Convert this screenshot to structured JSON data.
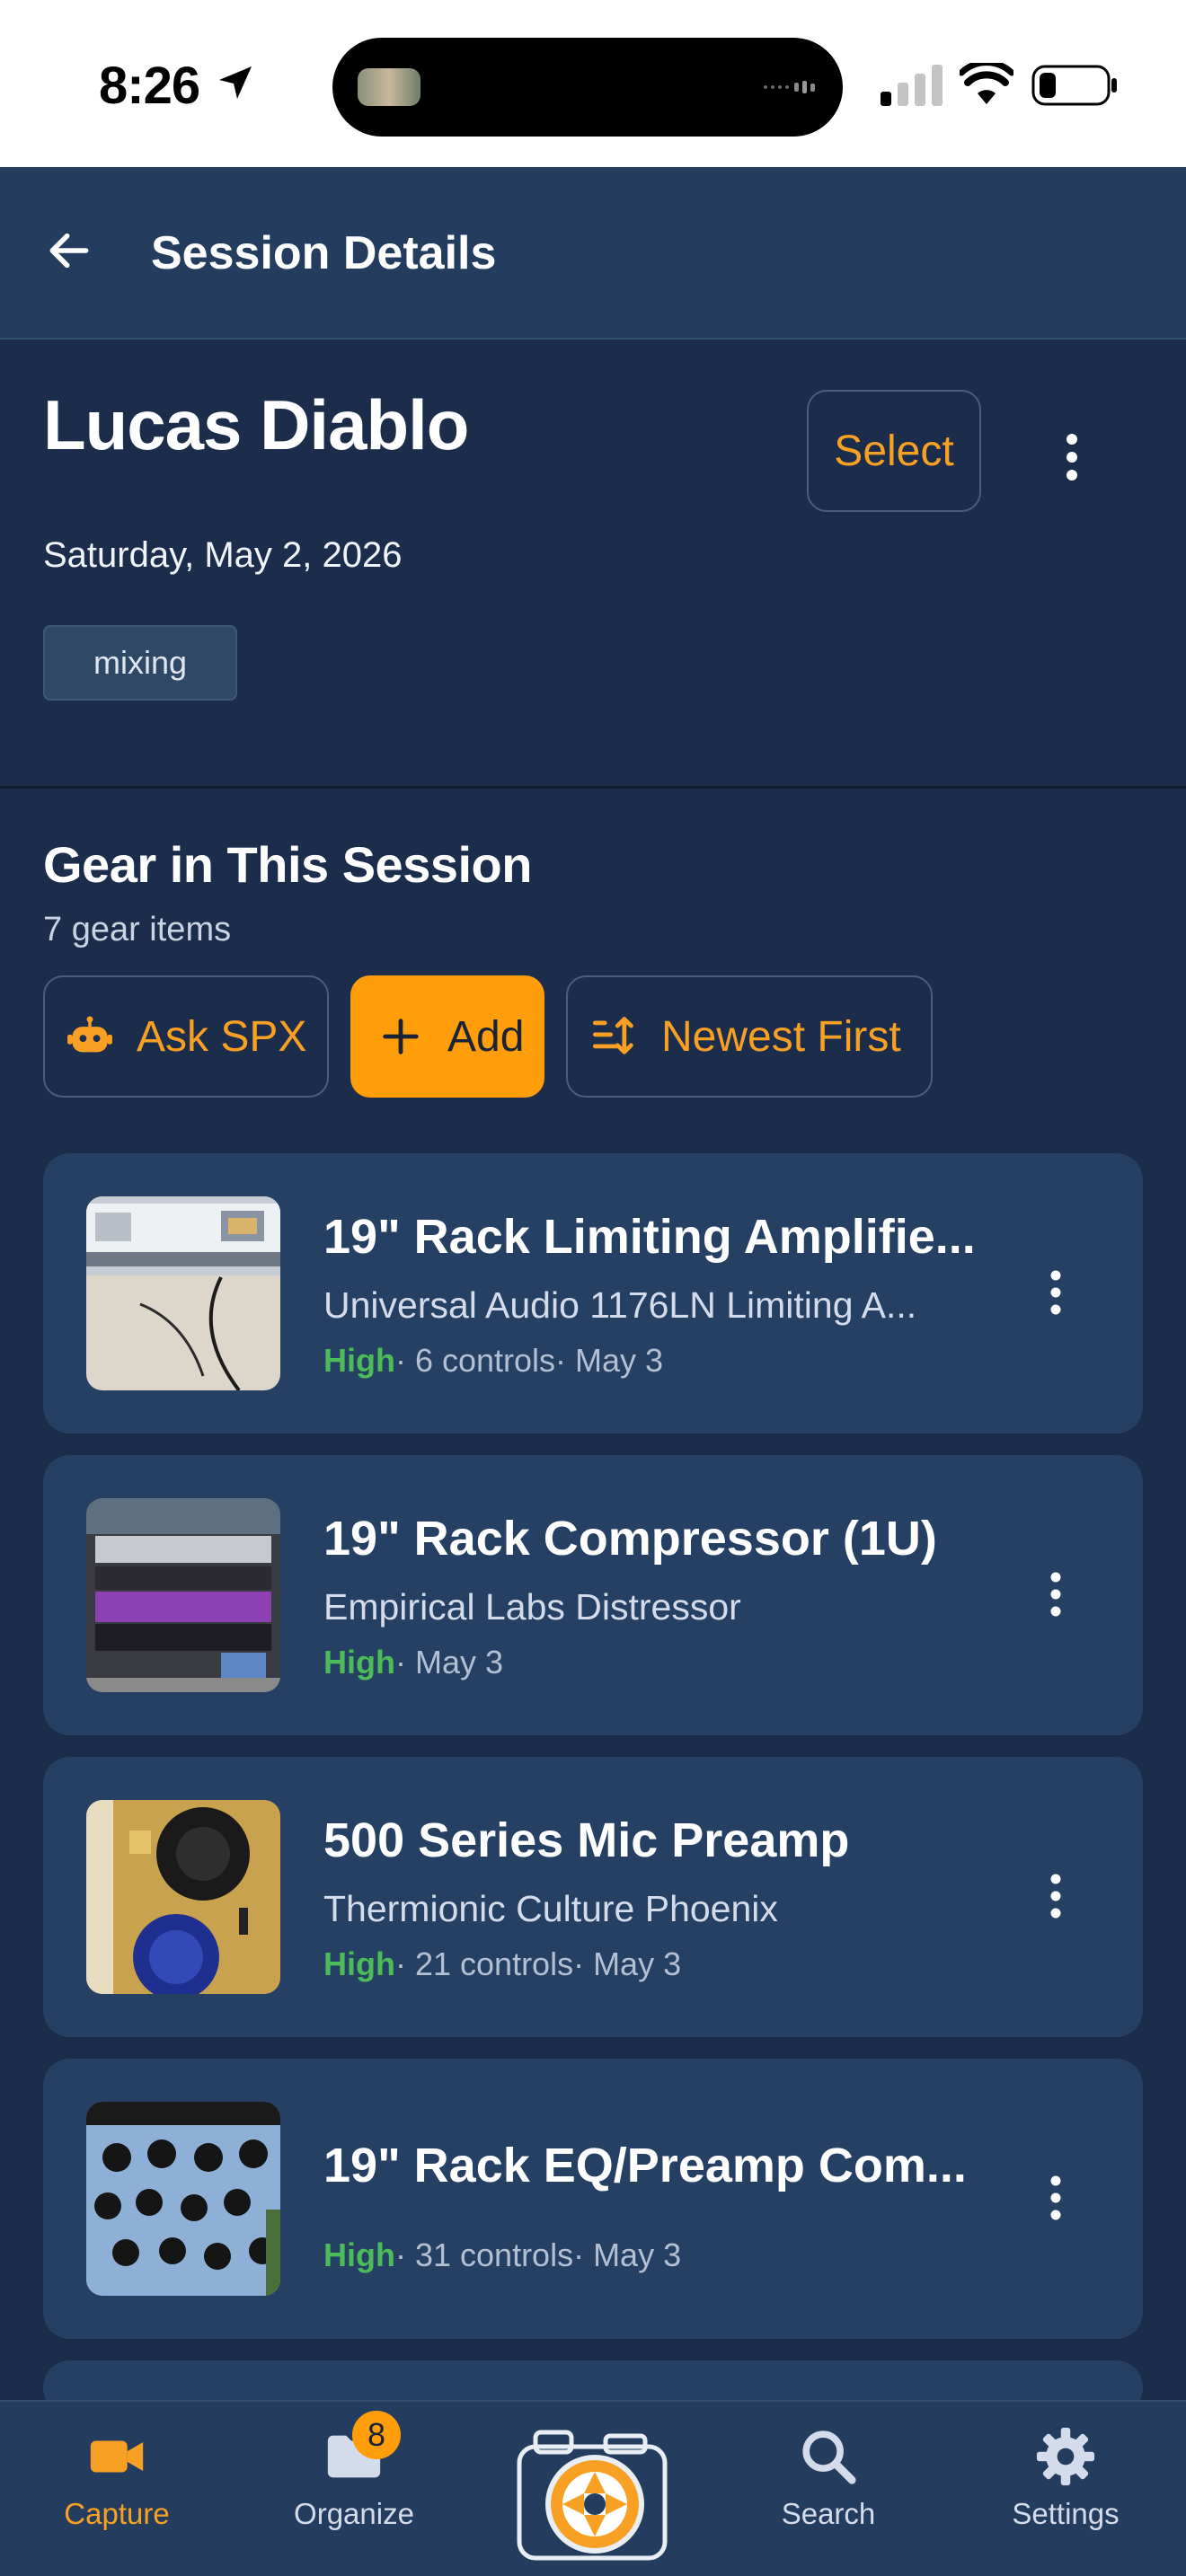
{
  "status_bar": {
    "time": "8:26"
  },
  "header": {
    "title": "Session Details"
  },
  "session": {
    "name": "Lucas Diablo",
    "select_label": "Select",
    "date": "Saturday, May 2, 2026",
    "tag": "mixing"
  },
  "gear_section": {
    "title": "Gear in This Session",
    "count": "7 gear items",
    "ask_label": "Ask SPX",
    "add_label": "Add",
    "sort_label": "Newest First"
  },
  "gear_items": [
    {
      "title": "19\" Rack Limiting Amplifie...",
      "subtitle": "Universal Audio 1176LN Limiting A...",
      "confidence": "High",
      "meta": "· 6 controls· May 3"
    },
    {
      "title": "19\" Rack Compressor (1U)",
      "subtitle": "Empirical Labs Distressor",
      "confidence": "High",
      "meta": "· May 3"
    },
    {
      "title": "500 Series Mic Preamp",
      "subtitle": "Thermionic Culture Phoenix",
      "confidence": "High",
      "meta": "· 21 controls· May 3"
    },
    {
      "title": "19\" Rack EQ/Preamp Com...",
      "subtitle": "",
      "confidence": "High",
      "meta": "· 31 controls· May 3"
    }
  ],
  "bottom_nav": {
    "capture": "Capture",
    "organize": "Organize",
    "organize_badge": "8",
    "search": "Search",
    "settings": "Settings"
  },
  "colors": {
    "accent": "#ff9e0a",
    "background": "#1c2d4b",
    "card": "#264064",
    "header": "#243d5e",
    "confidence_high": "#4cbb5a"
  },
  "icons": [
    "location-arrow-icon",
    "signal-icon",
    "wifi-icon",
    "battery-icon",
    "back-arrow-icon",
    "more-vertical-icon",
    "robot-icon",
    "plus-icon",
    "sort-icon",
    "video-camera-icon",
    "folder-icon",
    "camera-aperture-icon",
    "search-icon",
    "gear-icon"
  ]
}
